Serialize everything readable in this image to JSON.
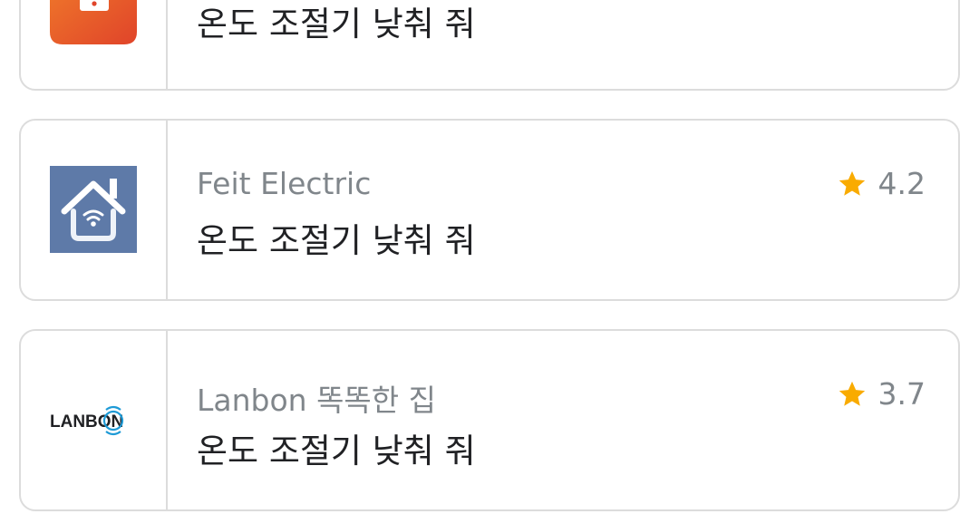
{
  "items": [
    {
      "app_name": "",
      "command": "온도 조절기 낮춰 줘",
      "rating": "",
      "icon": "orange-app-icon",
      "icon_color": "#e8502a"
    },
    {
      "app_name": "Feit Electric",
      "command": "온도 조절기 낮춰 줘",
      "rating": "4.2",
      "icon": "house-wifi-icon",
      "icon_color": "#5e7aa8"
    },
    {
      "app_name": "Lanbon 똑똑한 집",
      "command": "온도 조절기 낮춰 줘",
      "rating": "3.7",
      "icon": "lanbon-logo",
      "logo_text": "LANBON"
    }
  ],
  "colors": {
    "star": "#f9ab00",
    "border": "#dcdcdc",
    "secondary_text": "#80868b",
    "primary_text": "#202124"
  }
}
